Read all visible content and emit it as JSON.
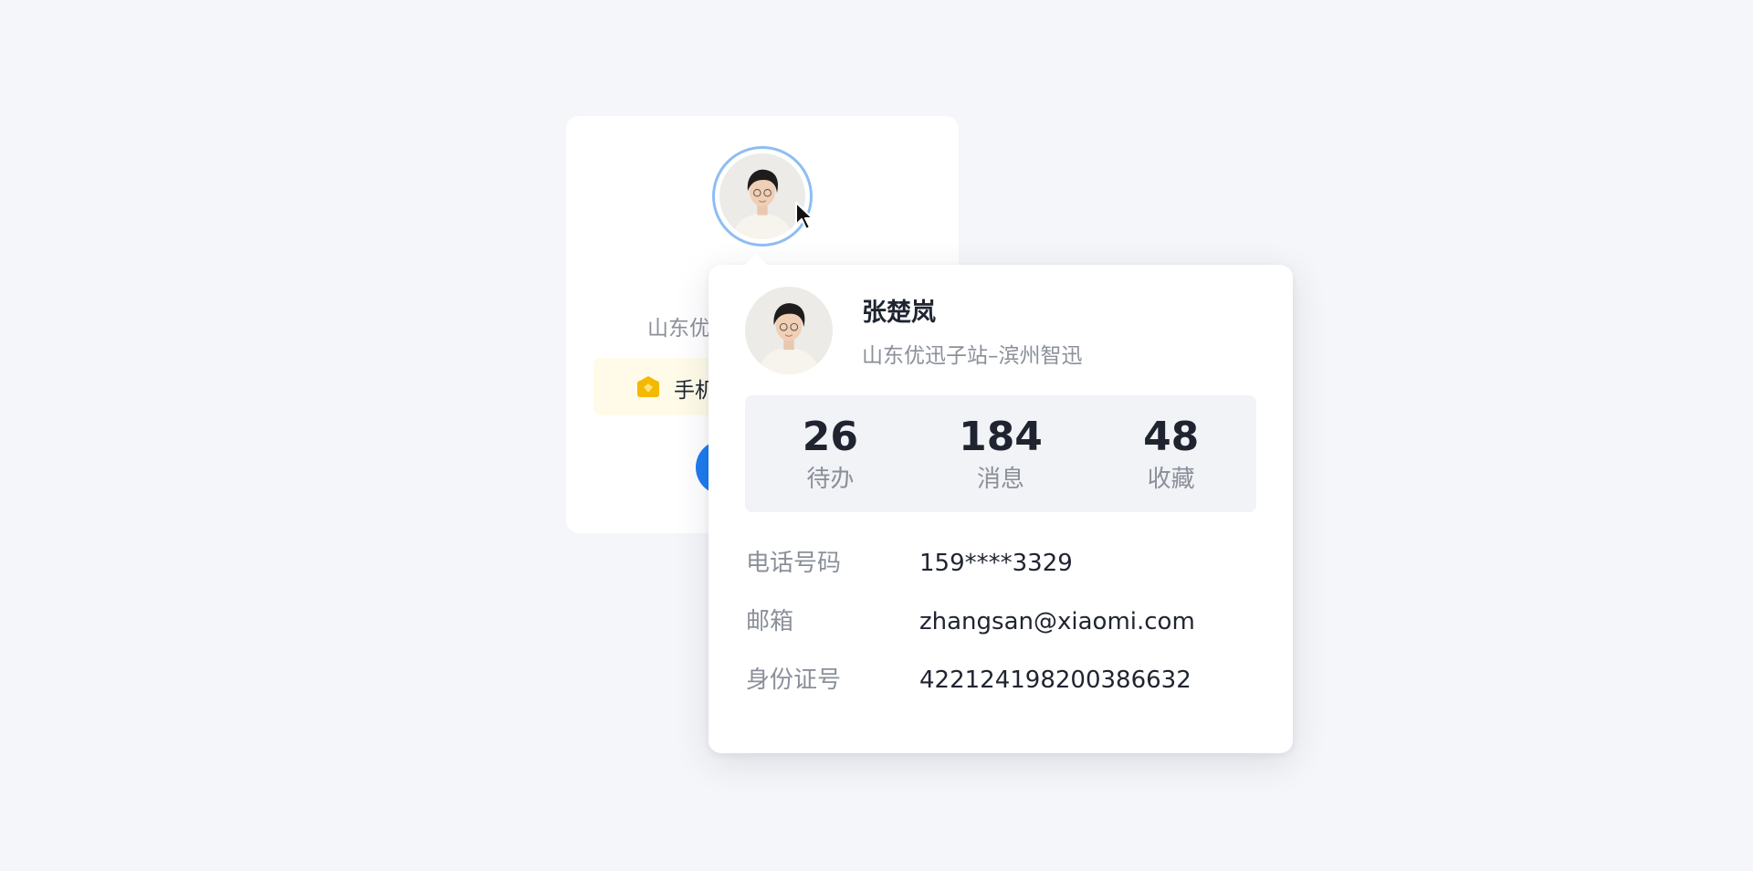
{
  "background_card": {
    "org_text": "山东优",
    "phone_banner_text": "手机"
  },
  "popover": {
    "name": "张楚岚",
    "org": "山东优迅子站–滨州智迅",
    "stats": [
      {
        "value": "26",
        "label": "待办"
      },
      {
        "value": "184",
        "label": "消息"
      },
      {
        "value": "48",
        "label": "收藏"
      }
    ],
    "info": [
      {
        "label": "电话号码",
        "value": "159****3329"
      },
      {
        "label": "邮箱",
        "value": "zhangsan@xiaomi.com"
      },
      {
        "label": "身份证号",
        "value": "422124198200386632"
      }
    ]
  },
  "colors": {
    "accent": "#1f7cf0",
    "avatar_ring": "#8fbdf2",
    "banner_bg": "#fffbe8",
    "banner_icon": "#f5b800"
  },
  "icons": {
    "banner_icon": "vip-crown-icon",
    "cursor": "mouse-pointer-icon"
  }
}
